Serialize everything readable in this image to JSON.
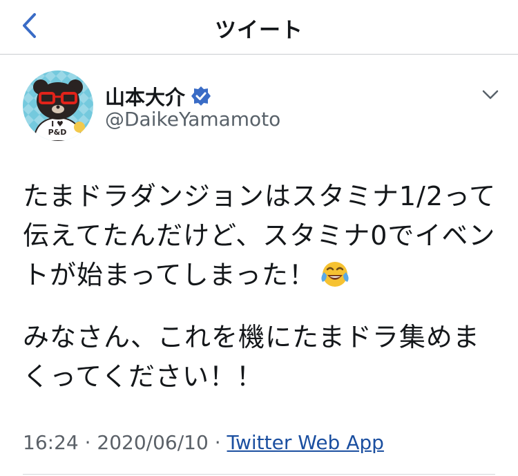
{
  "header": {
    "title": "ツイート"
  },
  "icons": {
    "back": "chevron-left-icon",
    "verified": "verified-badge-icon",
    "more": "chevron-down-icon",
    "emoji": "tears-of-joy-emoji"
  },
  "colors": {
    "verified": "#3a6cc6",
    "link": "#1b4fa0",
    "meta": "#5b6168",
    "avatar_bg": "#74c9dd"
  },
  "user": {
    "name": "山本大介",
    "handle": "@DaikeYamamoto",
    "avatar_text": [
      "I ♥",
      "P&D"
    ]
  },
  "tweet": {
    "paragraph1": "たまドラダンジョンはスタミナ1/2って伝えてたんだけど、スタミナ0でイベントが始まってしまった！",
    "paragraph2": "みなさん、これを機にたまドラ集めまくってください！！",
    "time": "16:24",
    "separator": "·",
    "date": "2020/06/10",
    "app": "Twitter Web App"
  }
}
